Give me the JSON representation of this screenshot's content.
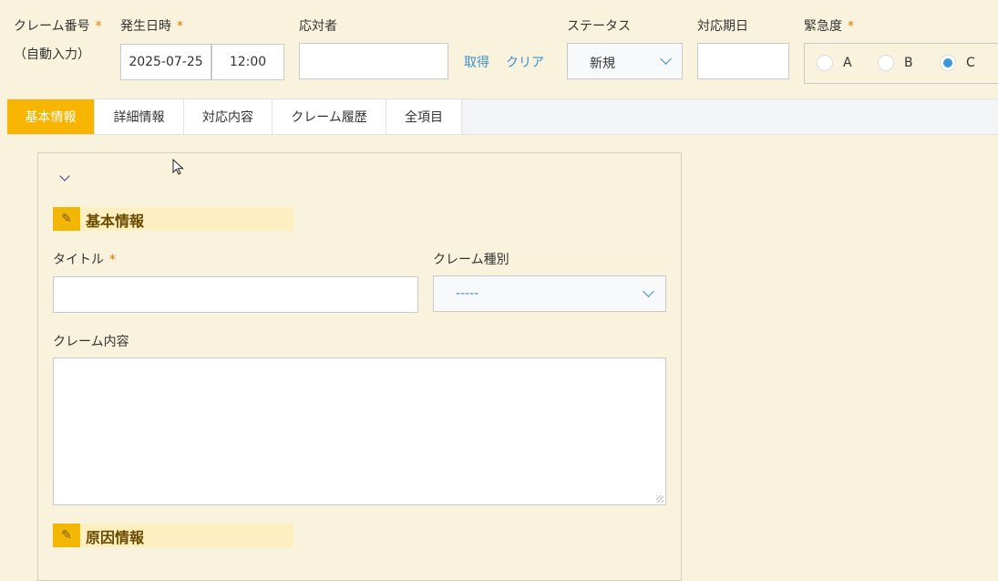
{
  "header": {
    "claim_no": {
      "label": "クレーム番号",
      "required": "*",
      "sub": "（自動入力）"
    },
    "occurred": {
      "label": "発生日時",
      "required": "*",
      "date": "2025-07-25",
      "time": "12:00"
    },
    "responder": {
      "label": "応対者",
      "value": "",
      "get_link": "取得",
      "clear_link": "クリア"
    },
    "status": {
      "label": "ステータス",
      "selected": "新規"
    },
    "due_date": {
      "label": "対応期日",
      "value": ""
    },
    "urgency": {
      "label": "緊急度",
      "required": "*",
      "options": [
        "A",
        "B",
        "C"
      ],
      "selected": "C"
    }
  },
  "tabs": [
    "基本情報",
    "詳細情報",
    "対応内容",
    "クレーム履歴",
    "全項目"
  ],
  "active_tab": "基本情報",
  "section_basic": {
    "title": "基本情報",
    "title_field": {
      "label": "タイトル",
      "required": "*",
      "value": ""
    },
    "claim_type": {
      "label": "クレーム種別",
      "selected": "-----"
    },
    "claim_content": {
      "label": "クレーム内容",
      "value": ""
    }
  },
  "section_cause": {
    "title": "原因情報"
  },
  "colors": {
    "accent": "#f7b500",
    "link": "#3a8fcf",
    "background": "#f9f3dd",
    "required": "#e07b00"
  }
}
